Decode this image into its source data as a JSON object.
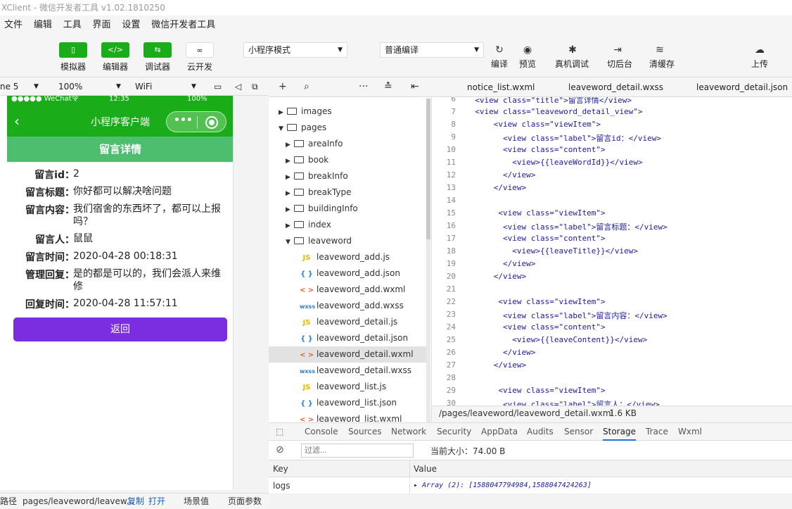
{
  "window_title": "XClient - 微信开发者工具 v1.02.1810250",
  "menu": [
    "文件",
    "编辑",
    "工具",
    "界面",
    "设置",
    "微信开发者工具"
  ],
  "toolbar": {
    "simulator": "模拟器",
    "editor": "编辑器",
    "debugger": "调试器",
    "cloud": "云开发",
    "mode": "小程序模式",
    "compile_mode": "普通编译",
    "compile": "编译",
    "preview": "预览",
    "remote_debug": "真机调试",
    "background": "切后台",
    "clear_cache": "清缓存",
    "upload": "上传"
  },
  "simbar": {
    "device": "ne 5",
    "zoom": "100%",
    "network": "WiFi"
  },
  "phone": {
    "status_carrier": "●●●●● WeChat令",
    "status_time": "12:35",
    "status_battery": "100%",
    "nav_title": "小程序客户端",
    "page_header": "留言详情",
    "fields": [
      {
        "label": "留言id：",
        "value": "2"
      },
      {
        "label": "留言标题：",
        "value": "你好都可以解决啥问题"
      },
      {
        "label": "留言内容：",
        "value": "我们宿舍的东西坏了，都可以上报吗？"
      },
      {
        "label": "留言人：",
        "value": "鼠鼠"
      },
      {
        "label": "留言时间：",
        "value": "2020-04-28 00:18:31"
      },
      {
        "label": "管理回复：",
        "value": "是的都是可以的，我们会派人来维修"
      },
      {
        "label": "回复时间：",
        "value": "2020-04-28 11:57:11"
      }
    ],
    "back_button": "返回"
  },
  "bottom": {
    "path_label": "路径",
    "path": "pages/leaveword/leavew...",
    "copy": "复制",
    "open": "打开",
    "scene": "场景值",
    "params": "页面参数"
  },
  "tree": {
    "items": [
      {
        "name": "images",
        "type": "folder",
        "level": 0,
        "open": false
      },
      {
        "name": "pages",
        "type": "folder",
        "level": 0,
        "open": true
      },
      {
        "name": "areaInfo",
        "type": "folder",
        "level": 1,
        "open": false
      },
      {
        "name": "book",
        "type": "folder",
        "level": 1,
        "open": false
      },
      {
        "name": "breakInfo",
        "type": "folder",
        "level": 1,
        "open": false
      },
      {
        "name": "breakType",
        "type": "folder",
        "level": 1,
        "open": false
      },
      {
        "name": "buildingInfo",
        "type": "folder",
        "level": 1,
        "open": false
      },
      {
        "name": "index",
        "type": "folder",
        "level": 1,
        "open": false
      },
      {
        "name": "leaveword",
        "type": "folder",
        "level": 1,
        "open": true
      },
      {
        "name": "leaveword_add.js",
        "type": "js",
        "level": 2
      },
      {
        "name": "leaveword_add.json",
        "type": "json",
        "level": 2
      },
      {
        "name": "leaveword_add.wxml",
        "type": "wxml",
        "level": 2
      },
      {
        "name": "leaveword_add.wxss",
        "type": "wxss",
        "level": 2
      },
      {
        "name": "leaveword_detail.js",
        "type": "js",
        "level": 2
      },
      {
        "name": "leaveword_detail.json",
        "type": "json",
        "level": 2
      },
      {
        "name": "leaveword_detail.wxml",
        "type": "wxml",
        "level": 2,
        "selected": true
      },
      {
        "name": "leaveword_detail.wxss",
        "type": "wxss",
        "level": 2
      },
      {
        "name": "leaveword_list.js",
        "type": "js",
        "level": 2
      },
      {
        "name": "leaveword_list.json",
        "type": "json",
        "level": 2
      },
      {
        "name": "leaveword_list.wxml",
        "type": "wxml",
        "level": 2
      }
    ]
  },
  "tabs": [
    "notice_list.wxml",
    "leaveword_detail.wxss",
    "leaveword_detail.json"
  ],
  "code_lines": [
    {
      "n": "6",
      "text": "  <view class=\"title\">留言详情</view>"
    },
    {
      "n": "7",
      "text": "  <view class=\"leaveword_detail_view\">"
    },
    {
      "n": "8",
      "text": "      <view class=\"viewItem\">"
    },
    {
      "n": "9",
      "text": "        <view class=\"label\">留言id：</view>"
    },
    {
      "n": "10",
      "text": "        <view class=\"content\">"
    },
    {
      "n": "11",
      "text": "          <view>{{leaveWordId}}</view>"
    },
    {
      "n": "12",
      "text": "        </view>"
    },
    {
      "n": "13",
      "text": "      </view>"
    },
    {
      "n": "14",
      "text": ""
    },
    {
      "n": "15",
      "text": "       <view class=\"viewItem\">"
    },
    {
      "n": "16",
      "text": "        <view class=\"label\">留言标题：</view>"
    },
    {
      "n": "17",
      "text": "        <view class=\"content\">"
    },
    {
      "n": "18",
      "text": "          <view>{{leaveTitle}}</view>"
    },
    {
      "n": "19",
      "text": "        </view>"
    },
    {
      "n": "20",
      "text": "      </view>"
    },
    {
      "n": "21",
      "text": ""
    },
    {
      "n": "22",
      "text": "       <view class=\"viewItem\">"
    },
    {
      "n": "23",
      "text": "        <view class=\"label\">留言内容：</view>"
    },
    {
      "n": "24",
      "text": "        <view class=\"content\">"
    },
    {
      "n": "25",
      "text": "          <view>{{leaveContent}}</view>"
    },
    {
      "n": "26",
      "text": "        </view>"
    },
    {
      "n": "27",
      "text": "      </view>"
    },
    {
      "n": "28",
      "text": ""
    },
    {
      "n": "29",
      "text": "       <view class=\"viewItem\">"
    },
    {
      "n": "30",
      "text": "        <view class=\"label\">留言人：</view>"
    }
  ],
  "file_path": "/pages/leaveword/leaveword_detail.wxml",
  "file_size": "1.6 KB",
  "devtools": {
    "tabs": [
      "Console",
      "Sources",
      "Network",
      "Security",
      "AppData",
      "Audits",
      "Sensor",
      "Storage",
      "Trace",
      "Wxml"
    ],
    "active_tab": "Storage",
    "filter_placeholder": "过滤...",
    "current_size": "当前大小：74.00 B",
    "col_key": "Key",
    "col_value": "Value",
    "row_key": "logs",
    "row_value": "▸ Array (2): [1588047794984,1588047424263]"
  }
}
